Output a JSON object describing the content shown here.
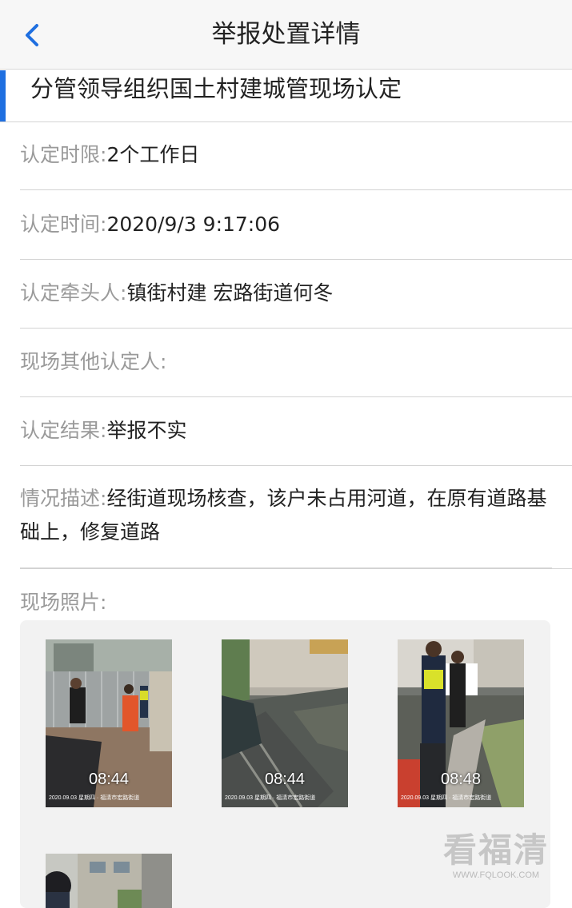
{
  "header": {
    "title": "举报处置详情",
    "back_icon": "chevron-left-icon",
    "accent_color": "#1f6fe0"
  },
  "section": {
    "title": "分管领导组织国土村建城管现场认定"
  },
  "fields": {
    "deadline_label": "认定时限:",
    "deadline_value": "2个工作日",
    "time_label": "认定时间:",
    "time_value": "2020/9/3 9:17:06",
    "lead_label": "认定牵头人:",
    "lead_value": "镇街村建 宏路街道何冬",
    "others_label": "现场其他认定人:",
    "others_value": "",
    "result_label": "认定结果:",
    "result_value": "举报不实",
    "desc_label": "情况描述:",
    "desc_value": "经街道现场核查，该户未占用河道，在原有道路基础上，修复道路"
  },
  "photos": {
    "label": "现场照片:",
    "items": [
      {
        "time": "08:44",
        "stamp": "2020.09.03 星期四 · 福清市宏路街道"
      },
      {
        "time": "08:44",
        "stamp": "2020.09.03 星期四 · 福清市宏路街道"
      },
      {
        "time": "08:48",
        "stamp": "2020.09.03 星期四 · 福清市宏路街道"
      },
      {
        "time": "",
        "stamp": ""
      }
    ]
  },
  "watermark": {
    "brand": "看福清",
    "url": "WWW.FQLOOK.COM"
  }
}
